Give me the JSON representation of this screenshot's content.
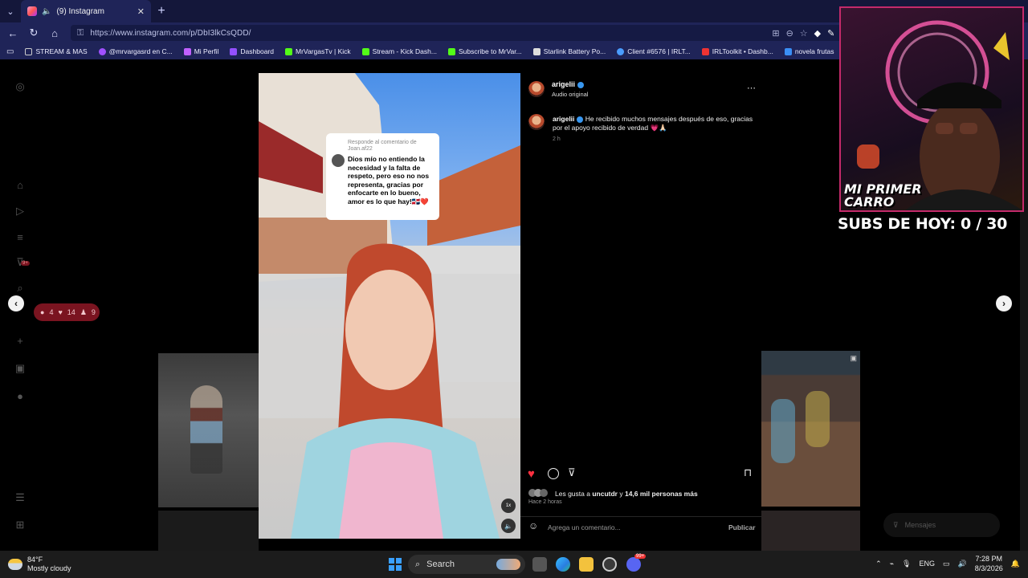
{
  "browser": {
    "tab_title": "(9) Instagram",
    "url": "https://www.instagram.com/p/DbI3lkCsQDD/",
    "bookmarks": [
      "STREAM & MAS",
      "@mrvargasrd en C...",
      "Mi Perfil",
      "Dashboard",
      "MrVargasTv | Kick",
      "Stream - Kick Dash...",
      "Subscribe to MrVar...",
      "Starlink Battery Po...",
      "Client #6576 | IRLT...",
      "IRLToolkit • Dashb...",
      "novela frutas",
      "Cu"
    ]
  },
  "sidebar": {
    "notification": {
      "comments": "4",
      "likes": "14",
      "follows": "9"
    },
    "unread_badge": "9+"
  },
  "post": {
    "username": "arigelii",
    "audio_label": "Audio original",
    "caption": "He recibido muchos mensajes después de eso, gracias por el apoyo recibido de verdad 💗🙏🏻",
    "caption_time": "2 h",
    "reply_card": {
      "header": "Responde al comentario de Joan.af22",
      "text": "Dios mío no entiendo la necesidad y la falta de respeto, pero eso no nos representa, gracias por enfocarte en lo bueno, amor es lo que hay!🇩🇴❤️"
    },
    "speed_label": "1x",
    "likes_prefix": "Les gusta a",
    "likes_user": "uncutdr",
    "likes_middle": "y",
    "likes_count": "14,6 mil personas más",
    "posted_ago": "Hace 2 horas",
    "comment_placeholder": "Agrega un comentario...",
    "publish_label": "Publicar"
  },
  "messages_label": "Mensajes",
  "stream_overlay": {
    "banner_text": "MI PRIMER CARRO",
    "subs_text": "SUBS DE HOY: 0 / 30"
  },
  "taskbar": {
    "temperature": "84°F",
    "weather": "Mostly cloudy",
    "search_label": "Search",
    "language": "ENG",
    "time": "7:28 PM",
    "date": "8/3/2026",
    "badge_count": "99+"
  },
  "colors": {
    "chrome": "#1f2458",
    "like_red": "#ff3040",
    "overlay_pink": "#c42a6a"
  }
}
